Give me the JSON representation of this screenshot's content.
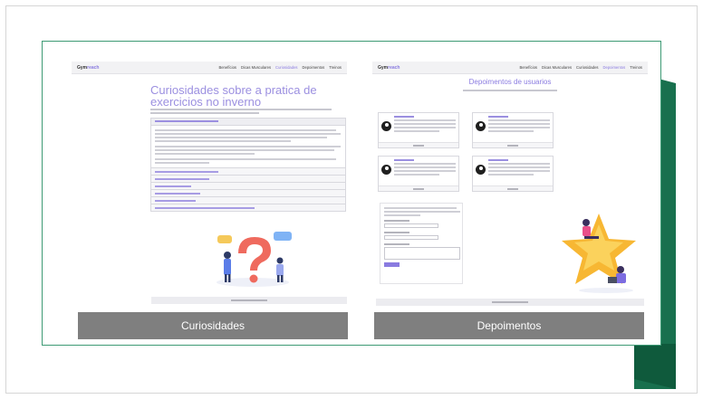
{
  "left_panel": {
    "caption": "Curiosidades",
    "nav": {
      "brand_main": "Gym",
      "brand_accent": "reach",
      "links": [
        "Benefícios",
        "Dicas Musculares",
        "Curiosidades",
        "Depoimentos",
        "Treinos"
      ],
      "active": "Curiosidades"
    },
    "title": "Curiosidades sobre a pratica de exercicios no inverno"
  },
  "right_panel": {
    "caption": "Depoimentos",
    "nav": {
      "brand_main": "Gym",
      "brand_accent": "reach",
      "links": [
        "Benefícios",
        "Dicas Musculares",
        "Curiosidades",
        "Depoimentos",
        "Treinos"
      ],
      "active": "Depoimentos"
    },
    "title": "Depoimentos de usuarios"
  },
  "colors": {
    "accent": "#8a7be0",
    "frame_border": "#3d9a74",
    "ribbon": "#18704e",
    "caption_bg": "#7f7f7f"
  }
}
